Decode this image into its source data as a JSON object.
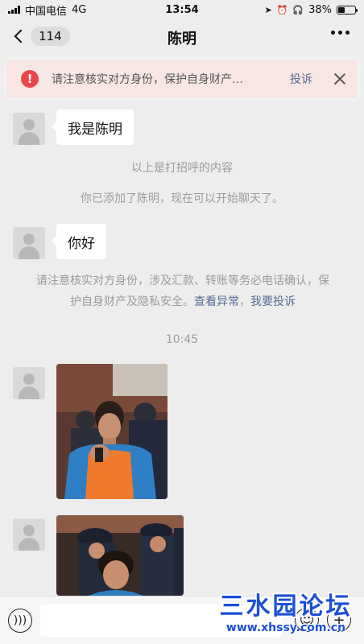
{
  "status_bar": {
    "carrier": "中国电信",
    "network": "4G",
    "time": "13:54",
    "battery": "38%",
    "battery_level": 0.38
  },
  "header": {
    "unread_count": "114",
    "title": "陈明"
  },
  "warning": {
    "icon": "exclamation-icon",
    "text": "请注意核实对方身份，保护自身财产…",
    "report": "投诉"
  },
  "messages": {
    "greeting_bubble": "我是陈明",
    "system_greeting": "以上是打招呼的内容",
    "system_added": "你已添加了陈明，现在可以开始聊天了。",
    "hello_bubble": "你好",
    "notice_text": "请注意核实对方身份，涉及汇款、转账等务必电话确认，保护自身财产及隐私安全。",
    "notice_link_1": "查看异常",
    "notice_link_2": "我要投诉",
    "timestamp": "10:45"
  },
  "watermark": {
    "main": "三水园论坛",
    "url": "www.xhssy.com.cn"
  },
  "colors": {
    "link": "#576b95",
    "warning_red": "#e8474c",
    "background": "#ededed"
  }
}
